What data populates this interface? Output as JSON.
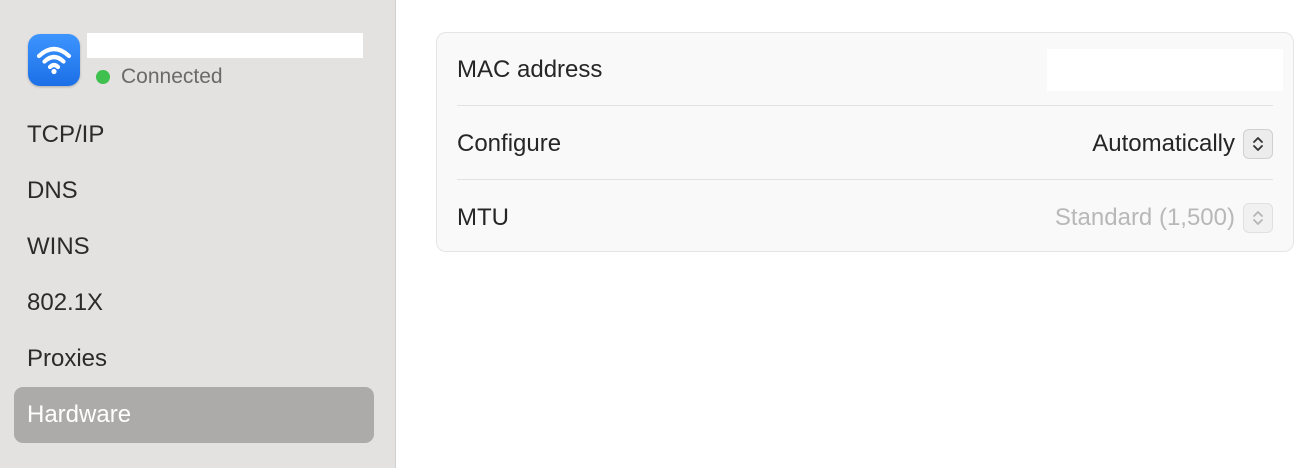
{
  "sidebar": {
    "network": {
      "name": "",
      "status": "Connected",
      "status_color": "#3fc04f",
      "icon": "wifi-icon"
    },
    "items": [
      {
        "label": "TCP/IP"
      },
      {
        "label": "DNS"
      },
      {
        "label": "WINS"
      },
      {
        "label": "802.1X"
      },
      {
        "label": "Proxies"
      },
      {
        "label": "Hardware",
        "selected": true
      }
    ]
  },
  "hardware": {
    "mac_address": {
      "label": "MAC address",
      "value": ""
    },
    "configure": {
      "label": "Configure",
      "value": "Automatically",
      "icon": "chevron-up-down-icon"
    },
    "mtu": {
      "label": "MTU",
      "value": "Standard (1,500)",
      "disabled": true,
      "icon": "chevron-up-down-icon"
    }
  },
  "colors": {
    "accent": "#1c6fe6",
    "selected_bg": "#adabaa",
    "sidebar_bg": "#e4e2e0"
  }
}
